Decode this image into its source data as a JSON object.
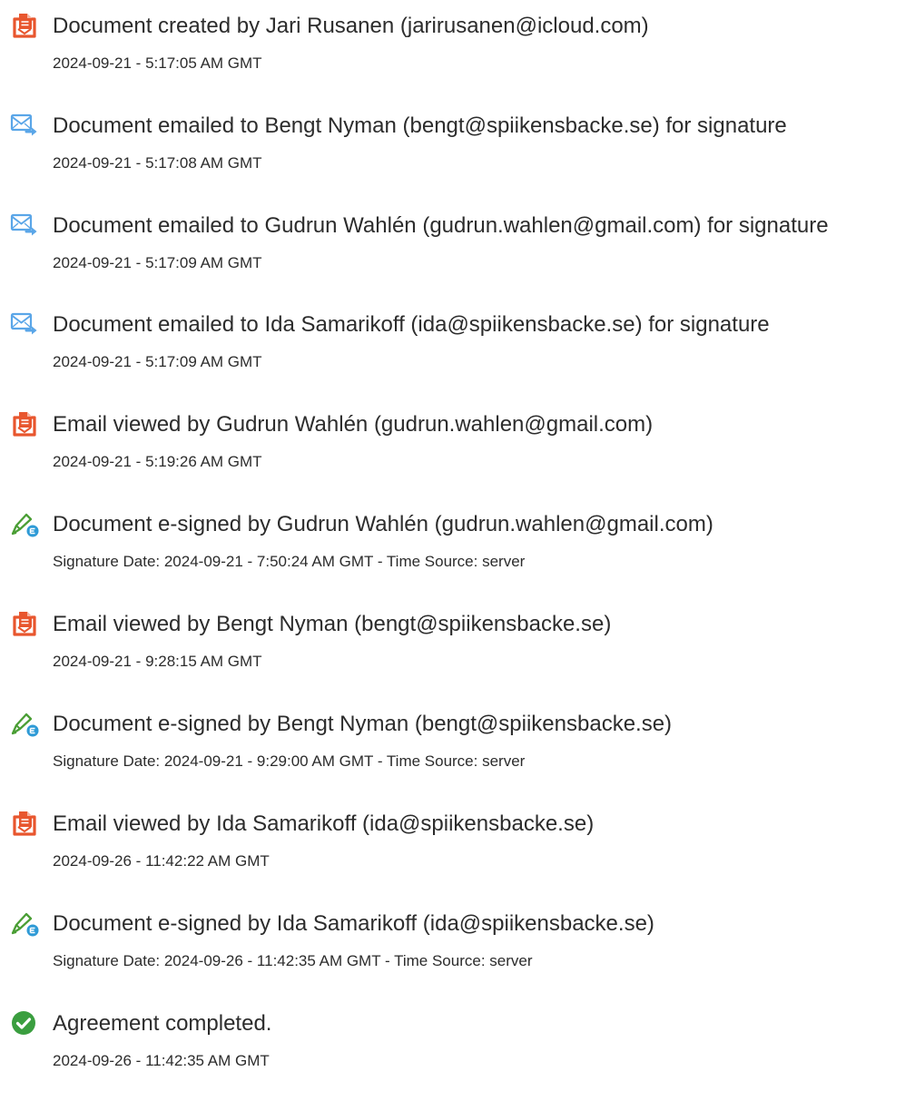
{
  "colors": {
    "document_icon": "#e8562e",
    "email_icon": "#5aa6e8",
    "sign_icon": "#4a9e35",
    "sign_badge": "#2e9ad6",
    "complete_icon": "#3a9e3f",
    "text": "#2c2c2c"
  },
  "events": [
    {
      "icon": "document-icon",
      "title": "Document created by Jari Rusanen (jarirusanen@icloud.com)",
      "meta": "2024-09-21 - 5:17:05 AM GMT"
    },
    {
      "icon": "email-sent-icon",
      "title": "Document emailed to Bengt Nyman (bengt@spiikensbacke.se) for signature",
      "meta": "2024-09-21 - 5:17:08 AM GMT"
    },
    {
      "icon": "email-sent-icon",
      "title": "Document emailed to Gudrun Wahlén (gudrun.wahlen@gmail.com) for signature",
      "meta": "2024-09-21 - 5:17:09 AM GMT"
    },
    {
      "icon": "email-sent-icon",
      "title": "Document emailed to Ida Samarikoff (ida@spiikensbacke.se) for signature",
      "meta": "2024-09-21 - 5:17:09 AM GMT"
    },
    {
      "icon": "document-icon",
      "title": "Email viewed by Gudrun Wahlén (gudrun.wahlen@gmail.com)",
      "meta": "2024-09-21 - 5:19:26 AM GMT"
    },
    {
      "icon": "e-sign-icon",
      "title": "Document e-signed by Gudrun Wahlén (gudrun.wahlen@gmail.com)",
      "meta": "Signature Date: 2024-09-21 - 7:50:24 AM GMT - Time Source: server"
    },
    {
      "icon": "document-icon",
      "title": "Email viewed by Bengt Nyman (bengt@spiikensbacke.se)",
      "meta": "2024-09-21 - 9:28:15 AM GMT"
    },
    {
      "icon": "e-sign-icon",
      "title": "Document e-signed by Bengt Nyman (bengt@spiikensbacke.se)",
      "meta": "Signature Date: 2024-09-21 - 9:29:00 AM GMT - Time Source: server"
    },
    {
      "icon": "document-icon",
      "title": "Email viewed by Ida Samarikoff (ida@spiikensbacke.se)",
      "meta": "2024-09-26 - 11:42:22 AM GMT"
    },
    {
      "icon": "e-sign-icon",
      "title": "Document e-signed by Ida Samarikoff (ida@spiikensbacke.se)",
      "meta": "Signature Date: 2024-09-26 - 11:42:35 AM GMT - Time Source: server"
    },
    {
      "icon": "checkmark-circle-icon",
      "title": "Agreement completed.",
      "meta": "2024-09-26 - 11:42:35 AM GMT"
    }
  ]
}
